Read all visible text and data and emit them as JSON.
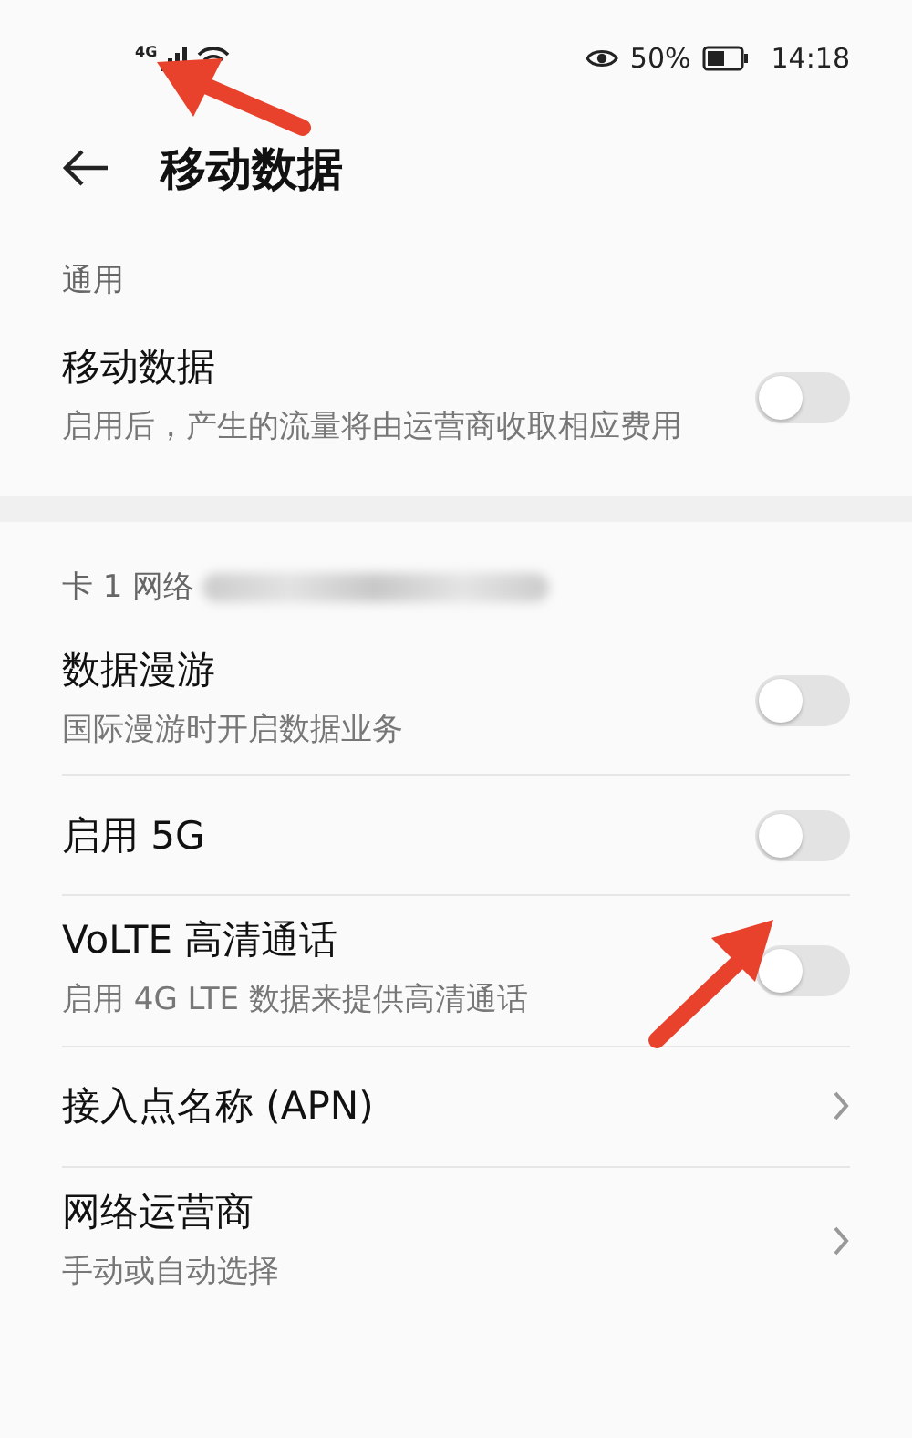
{
  "status_bar": {
    "network": "4G",
    "battery": "50%",
    "time": "14:18"
  },
  "header": {
    "title": "移动数据"
  },
  "sections": [
    {
      "header": "通用",
      "rows": [
        {
          "kind": "toggle",
          "title": "移动数据",
          "subtitle": "启用后，产生的流量将由运营商收取相应费用",
          "on": false
        }
      ]
    },
    {
      "header": "卡 1 网络",
      "rows": [
        {
          "kind": "toggle",
          "title": "数据漫游",
          "subtitle": "国际漫游时开启数据业务",
          "on": false
        },
        {
          "kind": "toggle",
          "title": "启用 5G",
          "on": false
        },
        {
          "kind": "toggle",
          "title": "VoLTE 高清通话",
          "subtitle": "启用 4G LTE 数据来提供高清通话",
          "on": false
        },
        {
          "kind": "link",
          "title": "接入点名称 (APN)"
        },
        {
          "kind": "link",
          "title": "网络运营商",
          "subtitle": "手动或自动选择"
        }
      ]
    }
  ]
}
